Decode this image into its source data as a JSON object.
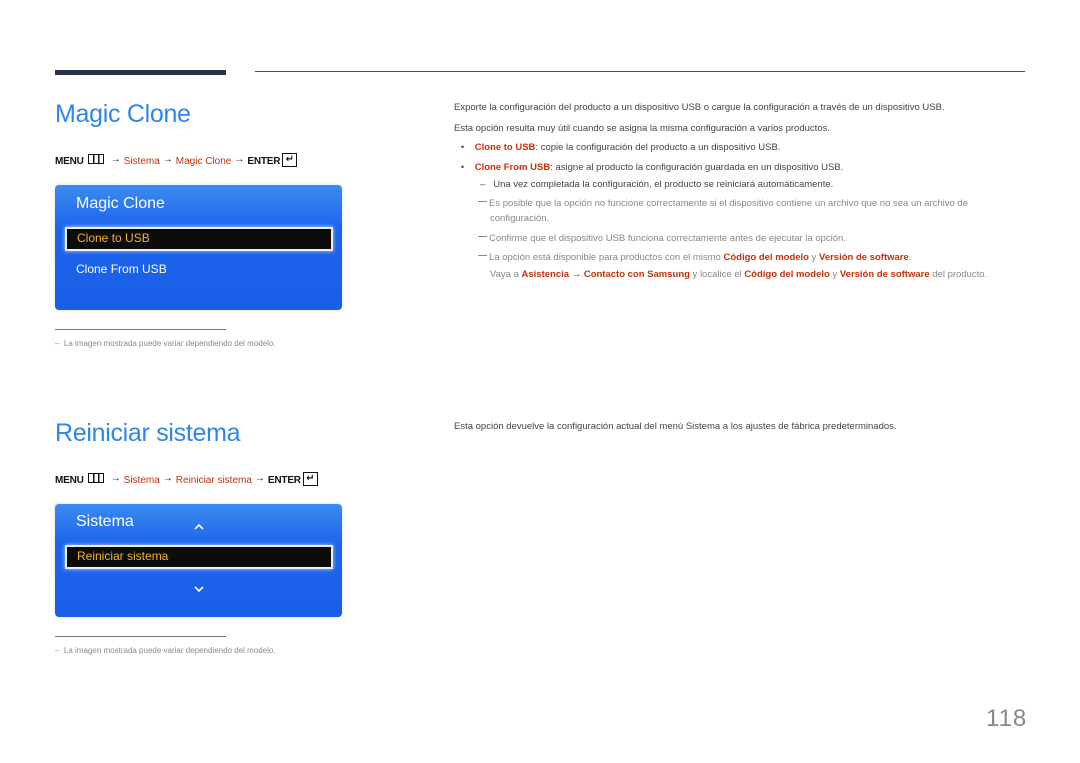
{
  "page_number": "118",
  "colors": {
    "heading": "#2e86e8",
    "highlight": "#c7310a",
    "osd_blue": "#1d64ec",
    "osd_selected_text": "#f1b52a"
  },
  "sections": [
    {
      "title": "Magic Clone",
      "menu_path": {
        "menu": "MENU",
        "menu_icon": "menu-grid-icon",
        "arrow": "→",
        "step1": "Sistema",
        "step2": "Magic Clone",
        "enter": "ENTER",
        "enter_icon": "enter-icon"
      },
      "osd": {
        "title": "Magic Clone",
        "items": [
          {
            "label": "Clone to USB",
            "selected": true
          },
          {
            "label": "Clone From USB",
            "selected": false
          }
        ]
      },
      "footnote": "La imagen mostrada puede variar dependiendo del modelo.",
      "description": [
        "Exporte la configuración del producto a un dispositivo USB o cargue la configuración a través de un dispositivo USB.",
        "Esta opción resulta muy útil cuando se asigna la misma configuración a varios productos."
      ],
      "bullets": [
        {
          "term": "Clone to USB",
          "text": ": copie la configuración del producto a un dispositivo USB."
        },
        {
          "term": "Clone From USB",
          "text": ": asigne al producto la configuración guardada en un dispositivo USB.",
          "sub": "Una vez completada la configuración, el producto se reiniciará automáticamente."
        }
      ],
      "notes": {
        "n1_line1": "Es posible que la opción no funcione correctamente si el dispositivo contiene un archivo que no sea un archivo de",
        "n1_line2": "configuración.",
        "n2": "Confirme que el dispositivo USB funciona correctamente antes de ejecutar la opción.",
        "n3_a": "La opción está disponible para productos con el mismo ",
        "n3_b": "Código del modelo",
        "n3_c": " y ",
        "n3_d": "Versión de software",
        "n3_e": ".",
        "n3_l2_a": "Vaya a ",
        "n3_l2_b": "Asistencia",
        "n3_l2_arrow": "→",
        "n3_l2_c": "Contacto con Samsung",
        "n3_l2_d": " y localice el ",
        "n3_l2_e": "Código del modelo",
        "n3_l2_f": " y ",
        "n3_l2_g": "Versión de software",
        "n3_l2_h": " del producto."
      }
    },
    {
      "title": "Reiniciar sistema",
      "menu_path": {
        "menu": "MENU",
        "menu_icon": "menu-grid-icon",
        "arrow": "→",
        "step1": "Sistema",
        "step2": "Reiniciar sistema",
        "enter": "ENTER",
        "enter_icon": "enter-icon"
      },
      "osd": {
        "title": "Sistema",
        "up_icon": "^",
        "down_icon": "˅",
        "items": [
          {
            "label": "Reiniciar sistema",
            "selected": true
          }
        ]
      },
      "footnote": "La imagen mostrada puede variar dependiendo del modelo.",
      "description": [
        "Esta opción devuelve la configuración actual del menú Sistema a los ajustes de fábrica predeterminados."
      ]
    }
  ]
}
